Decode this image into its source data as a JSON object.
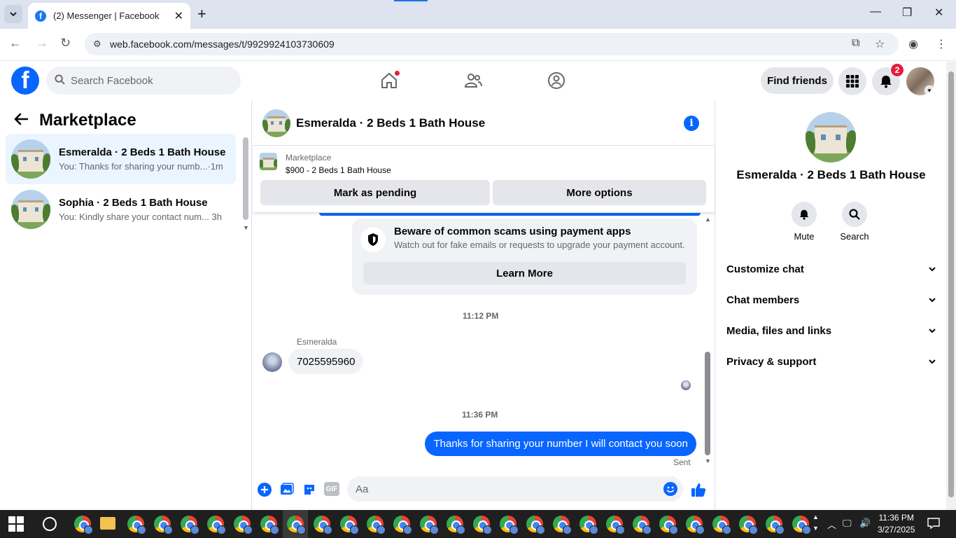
{
  "browser": {
    "tab_title": "(2) Messenger | Facebook",
    "url": "web.facebook.com/messages/t/9929924103730609"
  },
  "header": {
    "search_placeholder": "Search Facebook",
    "find_friends": "Find friends",
    "notification_count": "2"
  },
  "left_panel": {
    "title": "Marketplace",
    "conversations": [
      {
        "title": "Esmeralda · 2 Beds 1 Bath House",
        "preview": "You: Thanks for sharing your numb...",
        "time": "1m",
        "active": true
      },
      {
        "title": "Sophia · 2 Beds 1 Bath House",
        "preview": "You: Kindly share your contact num...",
        "time": "3h",
        "active": false
      }
    ]
  },
  "chat": {
    "title": "Esmeralda · 2 Beds 1 Bath House",
    "listing_label": "Marketplace",
    "listing_price": "$900 - 2 Beds 1 Bath House",
    "mark_pending": "Mark as pending",
    "more_options": "More options",
    "scam_title": "Beware of common scams using payment apps",
    "scam_text": "Watch out for fake emails or requests to upgrade your payment account.",
    "learn_more": "Learn More",
    "timestamp1": "11:12 PM",
    "sender_name": "Esmeralda",
    "incoming_message": "7025595960",
    "timestamp2": "11:36 PM",
    "outgoing_message": "Thanks for sharing your number I will contact you soon",
    "sent_status": "Sent",
    "composer_placeholder": "Aa",
    "gif_label": "GIF"
  },
  "right_panel": {
    "name": "Esmeralda · 2 Beds 1 Bath House",
    "mute": "Mute",
    "search": "Search",
    "sections": [
      "Customize chat",
      "Chat members",
      "Media, files and links",
      "Privacy & support"
    ]
  },
  "taskbar": {
    "time": "11:36 PM",
    "date": "3/27/2025"
  },
  "colors": {
    "accent": "#0866ff",
    "badge": "#e41e3f"
  }
}
